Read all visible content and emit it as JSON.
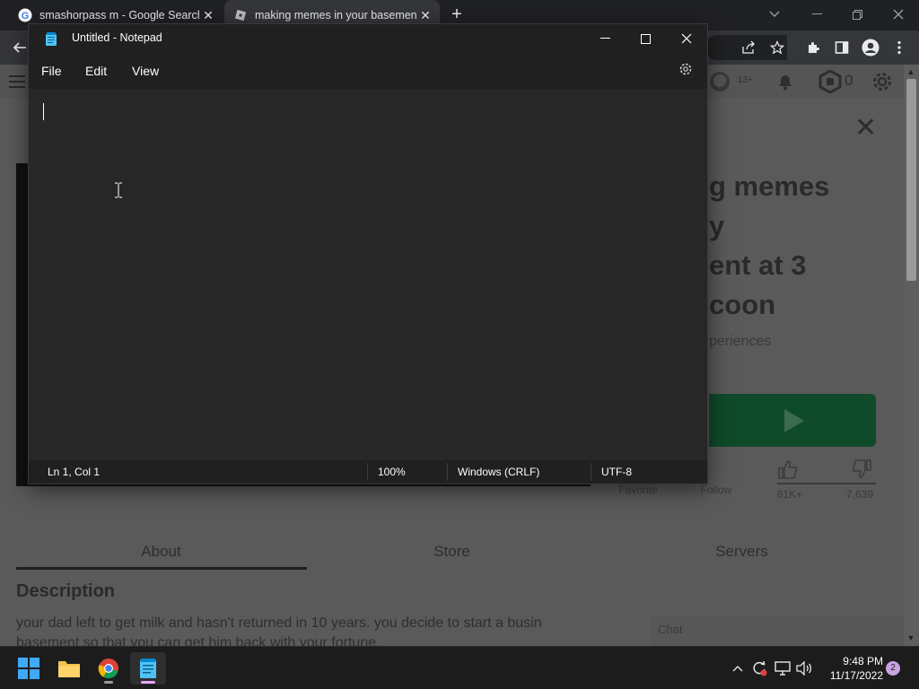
{
  "browser": {
    "tabs": [
      {
        "title": "smashorpass m - Google Search",
        "favicon": "google-icon",
        "active": false
      },
      {
        "title": "making memes in your basement",
        "favicon": "roblox-icon",
        "active": true
      }
    ],
    "new_tab_icon": "plus-icon"
  },
  "page": {
    "game_title_lines": [
      "g memes",
      "y",
      "ent at 3",
      "coon"
    ],
    "game_subtitle": "periences",
    "stats": {
      "favorite_label": "Favorite",
      "follow_label": "Follow",
      "likes": "61K+",
      "dislikes": "7,639"
    },
    "tabs": [
      "About",
      "Store",
      "Servers"
    ],
    "description_heading": "Description",
    "description_lines": [
      "your dad left to get milk and hasn't returned in 10 years. you decide to start a busin",
      "basement so that you can get him back with your fortune."
    ],
    "robux": "0",
    "chat_label": "Chat"
  },
  "notepad": {
    "title": "Untitled - Notepad",
    "menus": [
      "File",
      "Edit",
      "View"
    ],
    "content": "",
    "status": {
      "position": "Ln 1, Col 1",
      "zoom": "100%",
      "line_ending": "Windows (CRLF)",
      "encoding": "UTF-8"
    }
  },
  "taskbar": {
    "apps": [
      "start-button",
      "file-explorer",
      "chrome",
      "notepad"
    ],
    "time": "9:48 PM",
    "date": "11/17/2022",
    "notification_count": "2"
  },
  "colors": {
    "notepad_bg": "#272727",
    "notepad_bar": "#202020",
    "play_button": "#0f4a2a",
    "taskbar": "#1c1c1c",
    "accent_pink": "#e9a6ff"
  }
}
